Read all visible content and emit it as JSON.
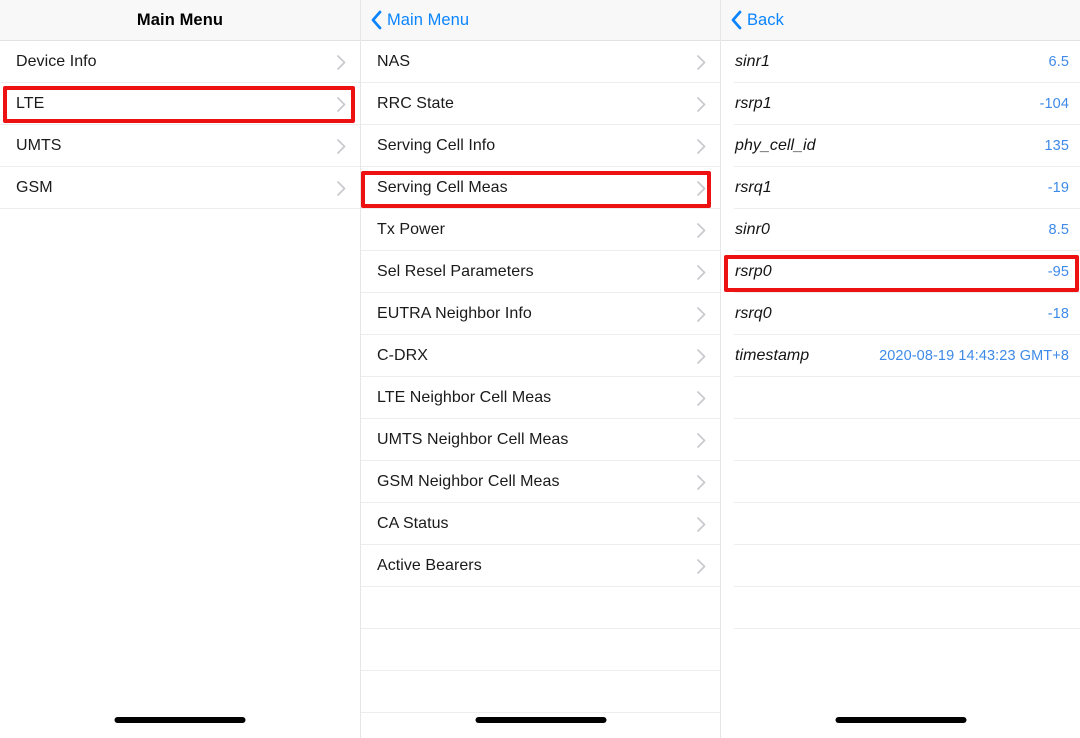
{
  "panels": [
    {
      "name": "main-menu",
      "nav": {
        "type": "title",
        "title": "Main Menu"
      },
      "rows": [
        {
          "label": "Device Info",
          "accessory": "chevron-right-icon"
        },
        {
          "label": "LTE",
          "accessory": "chevron-right-icon",
          "highlighted": true
        },
        {
          "label": "UMTS",
          "accessory": "chevron-right-icon"
        },
        {
          "label": "GSM",
          "accessory": "chevron-right-icon"
        }
      ],
      "empty_rows": 0
    },
    {
      "name": "lte-menu",
      "nav": {
        "type": "back",
        "back_label": "Main Menu",
        "back_icon": "chevron-left-icon"
      },
      "rows": [
        {
          "label": "NAS",
          "accessory": "chevron-right-icon"
        },
        {
          "label": "RRC State",
          "accessory": "chevron-right-icon"
        },
        {
          "label": "Serving Cell Info",
          "accessory": "chevron-right-icon"
        },
        {
          "label": "Serving Cell Meas",
          "accessory": "chevron-right-icon",
          "highlighted": true
        },
        {
          "label": "Tx Power",
          "accessory": "chevron-right-icon"
        },
        {
          "label": "Sel Resel Parameters",
          "accessory": "chevron-right-icon"
        },
        {
          "label": "EUTRA Neighbor Info",
          "accessory": "chevron-right-icon"
        },
        {
          "label": "C-DRX",
          "accessory": "chevron-right-icon"
        },
        {
          "label": "LTE Neighbor Cell Meas",
          "accessory": "chevron-right-icon"
        },
        {
          "label": "UMTS Neighbor Cell Meas",
          "accessory": "chevron-right-icon"
        },
        {
          "label": "GSM Neighbor Cell Meas",
          "accessory": "chevron-right-icon"
        },
        {
          "label": "CA Status",
          "accessory": "chevron-right-icon"
        },
        {
          "label": "Active Bearers",
          "accessory": "chevron-right-icon"
        }
      ],
      "empty_rows": 3
    },
    {
      "name": "serving-cell-meas",
      "nav": {
        "type": "back",
        "back_label": "Back",
        "back_icon": "chevron-left-icon"
      },
      "rows": [
        {
          "label": "sinr1",
          "value": "6.5"
        },
        {
          "label": "rsrp1",
          "value": "-104"
        },
        {
          "label": "phy_cell_id",
          "value": "135"
        },
        {
          "label": "rsrq1",
          "value": "-19"
        },
        {
          "label": "sinr0",
          "value": "8.5"
        },
        {
          "label": "rsrp0",
          "value": "-95",
          "highlighted": true
        },
        {
          "label": "rsrq0",
          "value": "-18"
        },
        {
          "label": "timestamp",
          "value": "2020-08-19 14:43:23 GMT+8"
        }
      ],
      "empty_rows": 6
    }
  ],
  "colors": {
    "accent_blue": "#0a84ff",
    "value_blue": "#3e8ae8",
    "highlight_red": "#ee1111",
    "navbar_bg": "#f8f8f8",
    "separator": "#ededed"
  }
}
